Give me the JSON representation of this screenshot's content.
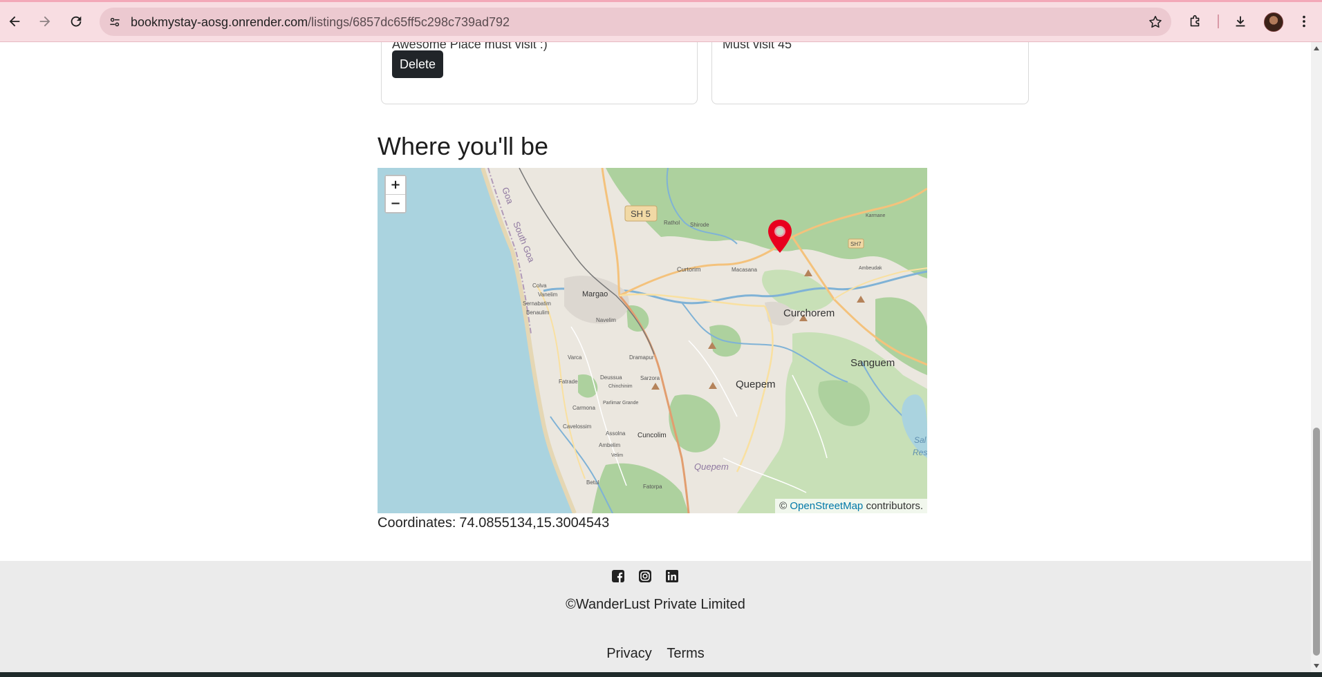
{
  "browser": {
    "url_host": "bookmystay-aosg.onrender.com",
    "url_path": "/listings/6857dc65ff5c298c739ad792"
  },
  "reviews": [
    {
      "comment": "Awesome Place must visit :)",
      "delete_label": "Delete"
    },
    {
      "comment": "Must visit 45"
    }
  ],
  "location": {
    "heading": "Where you'll be",
    "coordinates_label": "Coordinates:",
    "coordinates_value": "74.0855134,15.3004543"
  },
  "map": {
    "zoom_in": "+",
    "zoom_out": "−",
    "attribution_prefix": "©",
    "attribution_link": "OpenStreetMap",
    "attribution_suffix": "contributors.",
    "marker_color": "#e8001e",
    "water_color": "#aad3df",
    "labels": {
      "goa": "Goa",
      "south_goa": "South Goa",
      "sh5": "SH 5",
      "sh7": "SH7",
      "rathol": "Rathol",
      "shirode": "Shirode",
      "curtorim": "Curtorim",
      "macasana": "Macasana",
      "colva": "Colva",
      "vanelim": "Vanelim",
      "sernabatim": "Sernabatim",
      "benaulim": "Benaulim",
      "margao": "Margao",
      "navelim": "Navelim",
      "curchorem": "Curchorem",
      "sanguem": "Sanguem",
      "quepem": "Quepem",
      "quepem_district": "Quepem",
      "dramapur": "Dramapur",
      "sarzora": "Sarzora",
      "varca": "Varca",
      "deussua": "Deussua",
      "chinchinim": "Chinchinim",
      "fatrade": "Fatrade",
      "parlimar_grande": "Parlimar Grande",
      "carmona": "Carmona",
      "cavelossim": "Cavelossim",
      "assolna": "Assolna",
      "cuncolim": "Cuncolim",
      "ambelim": "Ambelim",
      "velim": "Velim",
      "betul": "Betul",
      "fatorpa": "Fatorpa",
      "karmane": "Karmane",
      "ambeudak": "Ambeudak",
      "sal": "Sal",
      "res": "Res"
    }
  },
  "footer": {
    "copyright": "©WanderLust Private Limited",
    "links": [
      "Privacy",
      "Terms"
    ]
  }
}
